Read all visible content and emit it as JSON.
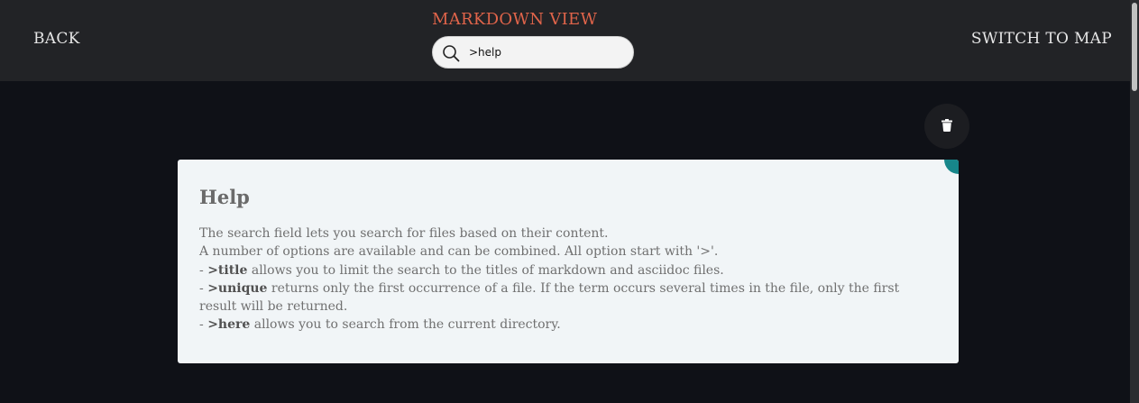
{
  "header": {
    "back_label": "BACK",
    "view_title": "MARKDOWN VIEW",
    "switch_label": "SWITCH TO MAP",
    "search": {
      "value": ">help",
      "icon": "search-icon"
    }
  },
  "actions": {
    "delete_icon": "trash-icon"
  },
  "help_card": {
    "title": "Help",
    "intro_line1": "The search field lets you search for files based on their content.",
    "intro_line2": "A number of options are available and can be combined. All option start with '>'.",
    "options": [
      {
        "prefix": "- ",
        "keyword": ">title",
        "description": " allows you to limit the search to the titles of markdown and asciidoc files."
      },
      {
        "prefix": "- ",
        "keyword": ">unique",
        "description": " returns only the first occurrence of a file. If the term occurs several times in the file, only the first result will be returned."
      },
      {
        "prefix": "- ",
        "keyword": ">here",
        "description": " allows you to search from the current directory."
      }
    ]
  },
  "colors": {
    "background": "#0f1117",
    "header": "#222326",
    "title_accent": "#e0644a",
    "card": "#f1f5f7",
    "corner_accent": "#17868a"
  }
}
